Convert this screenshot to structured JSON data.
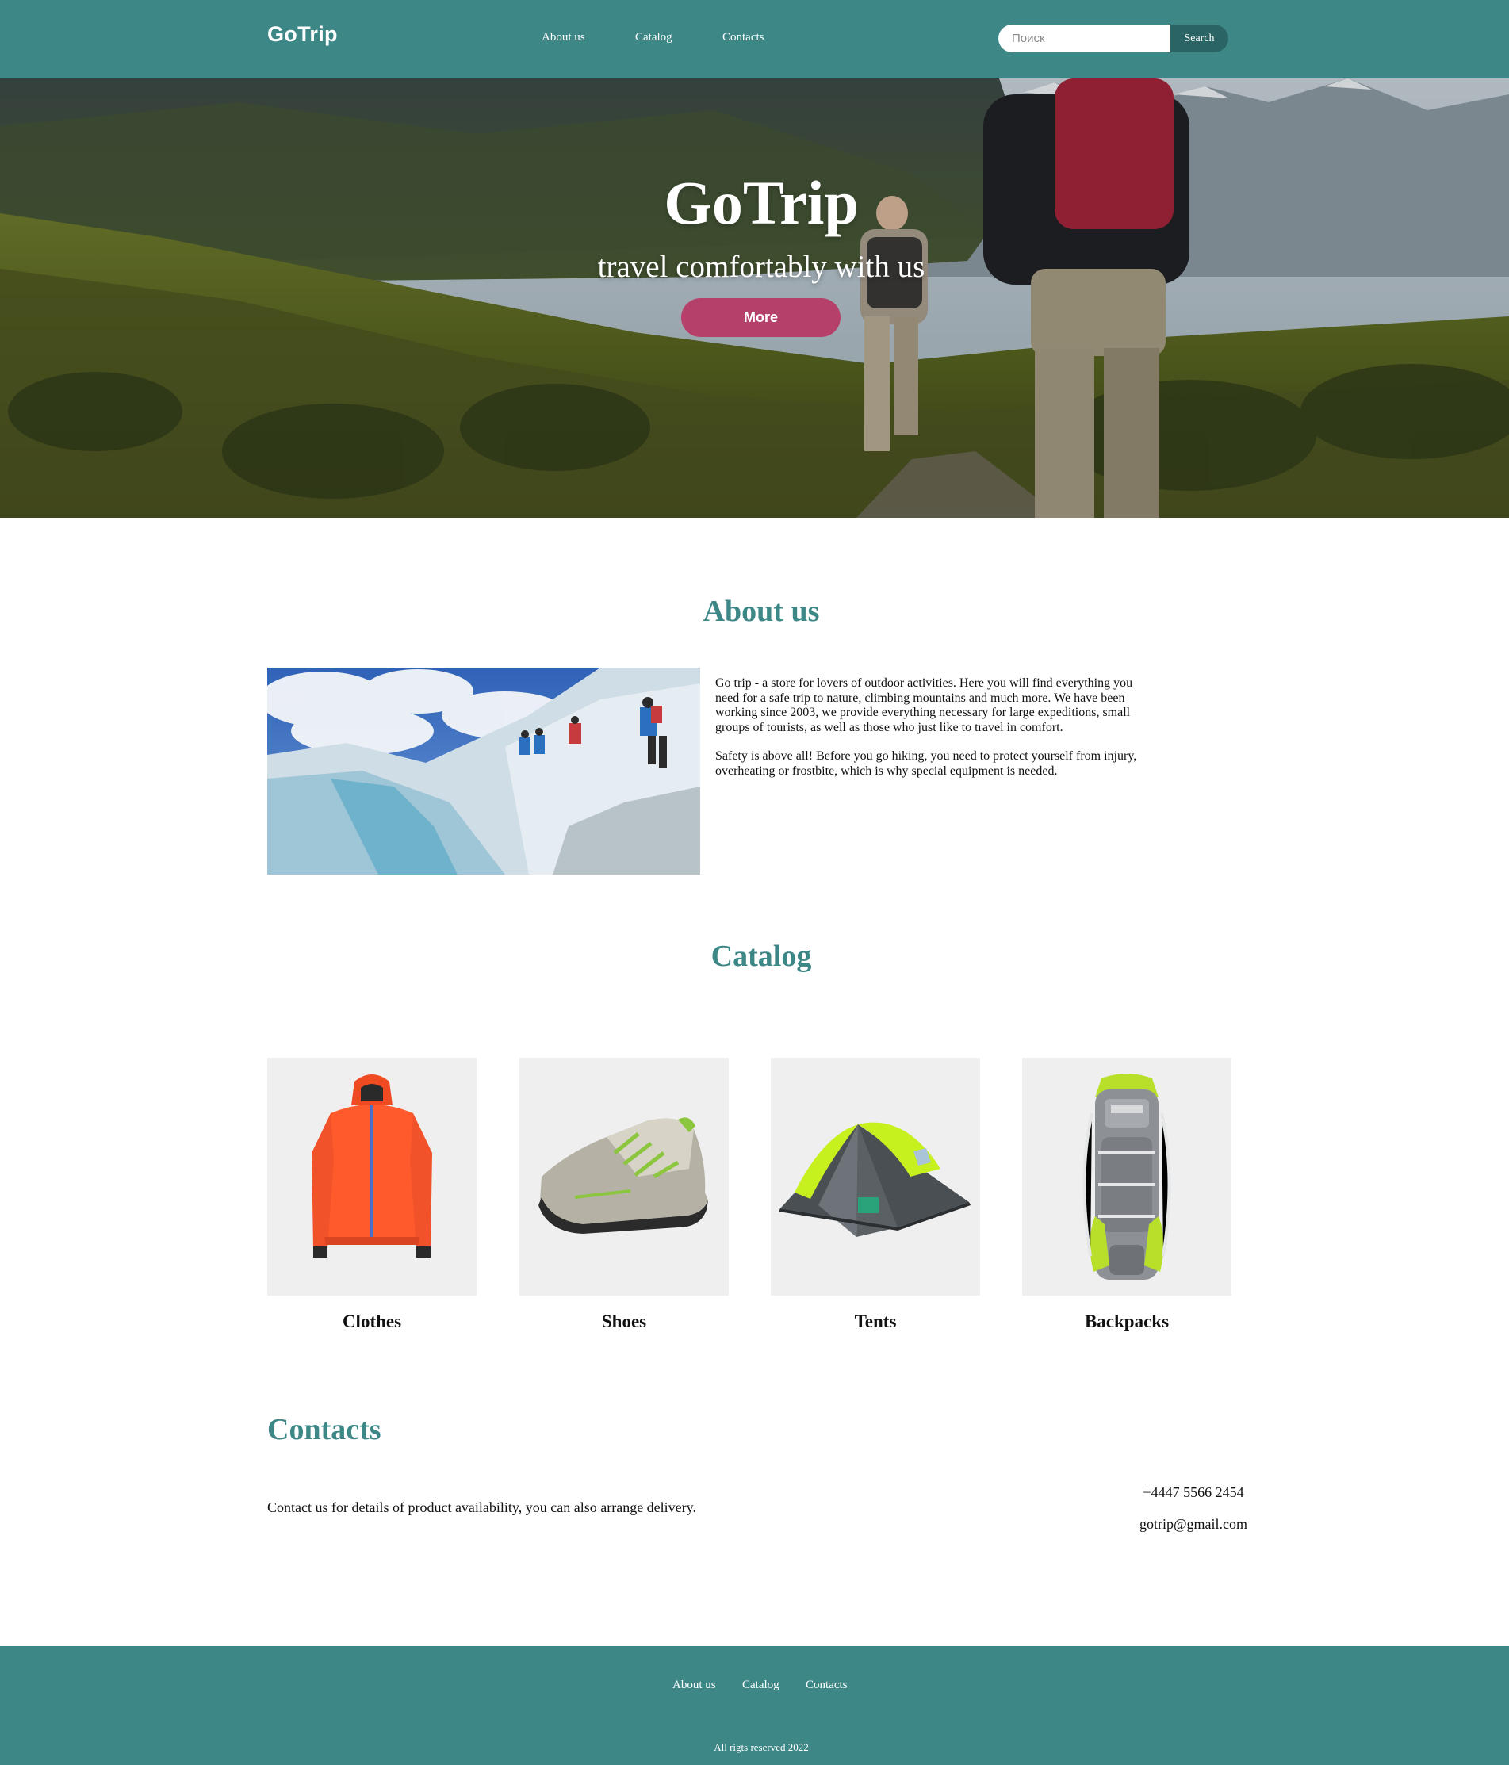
{
  "header": {
    "logo": "GoTrip",
    "nav": [
      "About us",
      "Catalog",
      "Contacts"
    ],
    "search_placeholder": "Поиск",
    "search_button": "Search"
  },
  "hero": {
    "title": "GoTrip",
    "subtitle": "travel comfortably with us",
    "button": "More"
  },
  "about": {
    "title": "About us",
    "paragraph1": "Go trip - a store for lovers of outdoor activities. Here you will find everything you need for a safe trip to nature, climbing mountains and much more. We have been working since 2003, we provide everything necessary for large expeditions, small groups of tourists, as well as those who just like to travel in comfort.",
    "paragraph2": "Safety is above all! Before you go hiking, you need to protect yourself from injury, overheating or frostbite, which is why special equipment is needed."
  },
  "catalog": {
    "title": "Catalog",
    "items": [
      {
        "label": "Clothes",
        "icon": "jacket-image"
      },
      {
        "label": "Shoes",
        "icon": "shoe-image"
      },
      {
        "label": "Tents",
        "icon": "tent-image"
      },
      {
        "label": "Backpacks",
        "icon": "backpack-image"
      }
    ]
  },
  "contacts": {
    "title": "Contacts",
    "text": "Contact us for details of product availability, you can also arrange delivery.",
    "phone": "+4447 5566 2454",
    "email": "gotrip@gmail.com"
  },
  "footer": {
    "nav": [
      "About us",
      "Catalog",
      "Contacts"
    ],
    "copyright": "All rigts reserved 2022"
  },
  "colors": {
    "brand": "#3d8787",
    "button_accent": "#b5416b",
    "search_button": "#2b6464"
  }
}
